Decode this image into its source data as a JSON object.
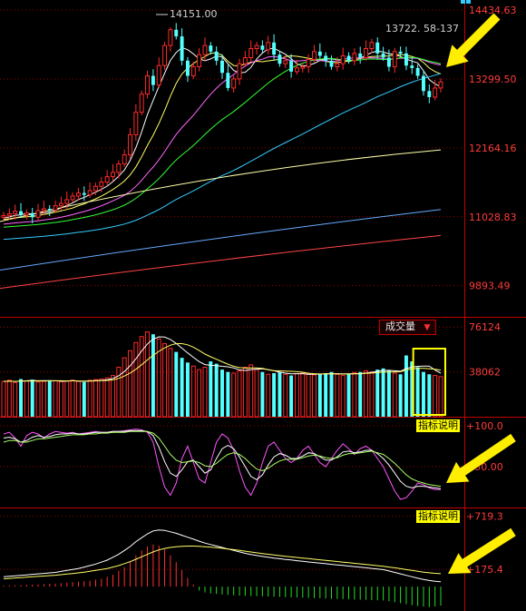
{
  "price_panel": {
    "axis_labels": [
      "14434.63",
      "13299.50",
      "12164.16",
      "11028.83",
      "9893.49"
    ],
    "high_annotation": "14151.00",
    "ma_readout": "13722. 58-137"
  },
  "volume_panel": {
    "title": "成交量",
    "axis_labels": [
      "76124",
      "38062"
    ]
  },
  "kdj_panel": {
    "title": "指标说明",
    "axis_labels": [
      "+100.0",
      "+50.00"
    ]
  },
  "macd_panel": {
    "title": "指标说明",
    "axis_labels": [
      "+719.3",
      "+175.4"
    ]
  },
  "colors": {
    "up_candle": "#ff2a2a",
    "down_candle": "#54ffff",
    "axis": "#c00000",
    "ma5": "#ffffff",
    "ma10": "#ffff66",
    "ma20": "#ff66ff",
    "ma30": "#33ff33",
    "ma60": "#33ccff",
    "ma120": "#ffffaa",
    "ma250": "#66aaff",
    "ma500": "#ff4444",
    "highlight": "#ffff00",
    "arrow": "#ffee00"
  },
  "chart_data": [
    {
      "type": "candlestick",
      "title": "",
      "ylim": [
        9380,
        14600
      ],
      "close": [
        11050,
        11080,
        11120,
        11060,
        11090,
        11020,
        11130,
        11160,
        11140,
        11210,
        11250,
        11310,
        11370,
        11420,
        11390,
        11460,
        11530,
        11600,
        11690,
        11760,
        11900,
        12050,
        12380,
        12750,
        13050,
        13350,
        13200,
        13520,
        13850,
        14110,
        14000,
        13600,
        13350,
        13500,
        13700,
        13850,
        13750,
        13600,
        13400,
        13150,
        13300,
        13550,
        13650,
        13800,
        13850,
        13780,
        13900,
        13700,
        13550,
        13600,
        13420,
        13480,
        13500,
        13620,
        13750,
        13680,
        13600,
        13500,
        13550,
        13680,
        13600,
        13720,
        13650,
        13800,
        13900,
        13720,
        13650,
        13500,
        13750,
        13720,
        13520,
        13480,
        13350,
        13100,
        13000,
        13150,
        13250
      ],
      "open": [
        11020,
        11050,
        11080,
        11120,
        11060,
        11090,
        11020,
        11130,
        11160,
        11140,
        11210,
        11250,
        11310,
        11370,
        11420,
        11390,
        11460,
        11530,
        11600,
        11690,
        11760,
        11900,
        12050,
        12380,
        12750,
        13050,
        13350,
        13200,
        13520,
        13850,
        14110,
        14000,
        13600,
        13350,
        13500,
        13700,
        13850,
        13750,
        13600,
        13400,
        13150,
        13300,
        13550,
        13650,
        13800,
        13850,
        13780,
        13900,
        13700,
        13550,
        13600,
        13420,
        13480,
        13500,
        13620,
        13750,
        13680,
        13600,
        13500,
        13550,
        13680,
        13600,
        13720,
        13650,
        13800,
        13900,
        13720,
        13650,
        13500,
        13750,
        13720,
        13520,
        13480,
        13350,
        13100,
        13000,
        13150
      ],
      "high": 14151.0
    },
    {
      "type": "bar",
      "title": "成交量",
      "values": [
        30000,
        31000,
        29000,
        32000,
        30500,
        31500,
        29500,
        30000,
        31000,
        30500,
        29800,
        30200,
        31000,
        30000,
        29500,
        31000,
        31500,
        32000,
        33000,
        35000,
        42000,
        50000,
        56000,
        63000,
        68000,
        72000,
        70000,
        66000,
        62000,
        58000,
        55000,
        50000,
        46000,
        43000,
        40000,
        42000,
        47000,
        45000,
        40000,
        38000,
        37000,
        39000,
        42000,
        44000,
        40000,
        38000,
        36000,
        37000,
        38000,
        36000,
        35000,
        36500,
        37000,
        36000,
        35500,
        36000,
        37000,
        38000,
        36000,
        35000,
        36000,
        37500,
        38000,
        39000,
        38000,
        40000,
        41000,
        39000,
        37000,
        36000,
        52000,
        47000,
        42000,
        38000,
        36000,
        35000,
        34000
      ],
      "ylim": [
        0,
        84000
      ]
    },
    {
      "type": "line",
      "title": "指标说明",
      "ylim": [
        0,
        110
      ],
      "series": [
        {
          "values": [
            90,
            92,
            85,
            75,
            88,
            92,
            90,
            85,
            90,
            93,
            92,
            91,
            92,
            90,
            91,
            92,
            93,
            92,
            92,
            93,
            93,
            94,
            95,
            96,
            95,
            92,
            80,
            50,
            25,
            15,
            30,
            60,
            75,
            55,
            35,
            30,
            55,
            80,
            90,
            85,
            70,
            45,
            25,
            15,
            30,
            55,
            75,
            80,
            70,
            60,
            55,
            60,
            70,
            75,
            65,
            55,
            50,
            60,
            70,
            78,
            72,
            65,
            72,
            75,
            70,
            60,
            50,
            35,
            20,
            10,
            12,
            20,
            30,
            28,
            24,
            22,
            22
          ]
        },
        {
          "values": [
            85,
            86,
            84,
            80,
            82,
            86,
            88,
            86,
            87,
            89,
            90,
            90,
            91,
            90,
            90,
            91,
            92,
            92,
            92,
            93,
            93,
            93,
            94,
            94,
            94,
            93,
            88,
            74,
            56,
            42,
            38,
            46,
            56,
            58,
            50,
            42,
            46,
            60,
            72,
            76,
            72,
            62,
            50,
            38,
            34,
            40,
            52,
            62,
            66,
            64,
            60,
            60,
            63,
            67,
            66,
            62,
            58,
            58,
            62,
            68,
            69,
            67,
            68,
            70,
            70,
            66,
            60,
            52,
            42,
            32,
            26,
            24,
            26,
            26,
            25,
            24,
            23
          ]
        },
        {
          "values": [
            80,
            82,
            82,
            80,
            80,
            82,
            84,
            84,
            85,
            86,
            87,
            88,
            89,
            89,
            89,
            90,
            90,
            91,
            91,
            92,
            92,
            92,
            93,
            93,
            93,
            93,
            91,
            85,
            75,
            65,
            58,
            55,
            56,
            57,
            55,
            51,
            50,
            54,
            60,
            65,
            67,
            65,
            60,
            53,
            47,
            45,
            48,
            53,
            57,
            59,
            59,
            59,
            61,
            63,
            64,
            63,
            61,
            60,
            61,
            64,
            66,
            66,
            67,
            68,
            69,
            67,
            65,
            60,
            54,
            47,
            40,
            35,
            32,
            30,
            28,
            27,
            26
          ]
        }
      ]
    },
    {
      "type": "bar",
      "title": "指标说明",
      "ylim": [
        -250,
        800
      ],
      "values": [
        10,
        12,
        14,
        15,
        18,
        20,
        22,
        25,
        28,
        30,
        35,
        40,
        45,
        50,
        55,
        60,
        70,
        80,
        100,
        120,
        160,
        200,
        260,
        320,
        370,
        410,
        430,
        420,
        380,
        320,
        250,
        170,
        90,
        20,
        -40,
        -60,
        -70,
        -75,
        -80,
        -85,
        -90,
        -92,
        -95,
        -96,
        -98,
        -100,
        -102,
        -104,
        -106,
        -108,
        -110,
        -112,
        -114,
        -116,
        -118,
        -120,
        -122,
        -124,
        -126,
        -128,
        -130,
        -132,
        -134,
        -136,
        -138,
        -140,
        -142,
        -150,
        -160,
        -170,
        -180,
        -190,
        -200,
        -205,
        -210,
        -205,
        -195
      ],
      "series": [
        {
          "values": [
            100,
            105,
            110,
            115,
            120,
            125,
            130,
            135,
            140,
            145,
            155,
            165,
            175,
            185,
            200,
            215,
            230,
            250,
            270,
            300,
            330,
            370,
            410,
            460,
            500,
            540,
            570,
            580,
            575,
            560,
            545,
            525,
            505,
            485,
            465,
            445,
            430,
            415,
            400,
            385,
            370,
            355,
            340,
            328,
            318,
            308,
            300,
            292,
            285,
            278,
            272,
            265,
            258,
            252,
            246,
            240,
            234,
            228,
            222,
            216,
            210,
            204,
            198,
            192,
            186,
            180,
            174,
            160,
            145,
            130,
            115,
            100,
            85,
            72,
            62,
            55,
            50
          ]
        },
        {
          "values": [
            80,
            84,
            88,
            92,
            96,
            100,
            104,
            108,
            112,
            116,
            122,
            128,
            134,
            140,
            148,
            156,
            165,
            175,
            185,
            200,
            215,
            235,
            255,
            280,
            305,
            330,
            355,
            375,
            390,
            400,
            408,
            412,
            414,
            414,
            412,
            408,
            404,
            398,
            392,
            385,
            378,
            370,
            362,
            354,
            346,
            338,
            331,
            324,
            317,
            310,
            304,
            298,
            292,
            286,
            280,
            274,
            268,
            262,
            256,
            250,
            244,
            238,
            232,
            226,
            220,
            214,
            208,
            200,
            192,
            183,
            174,
            165,
            156,
            148,
            141,
            136,
            132
          ]
        }
      ]
    }
  ]
}
